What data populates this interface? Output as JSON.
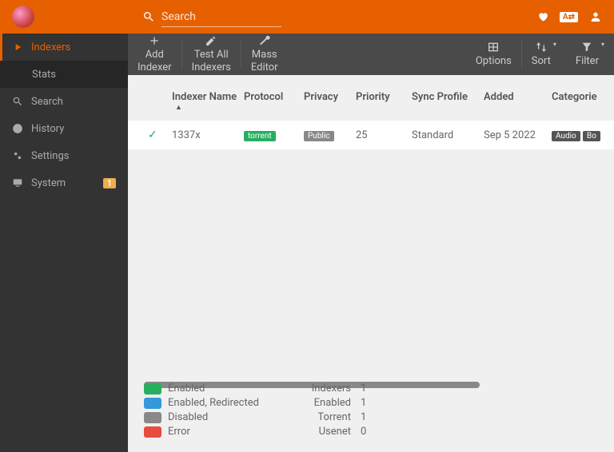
{
  "header": {
    "search_placeholder": "Search",
    "lang": "A⇄"
  },
  "nav": {
    "indexers": "Indexers",
    "stats": "Stats",
    "search": "Search",
    "history": "History",
    "settings": "Settings",
    "system": "System",
    "system_badge": "1"
  },
  "toolbar": {
    "add": "Add\nIndexer",
    "test": "Test All\nIndexers",
    "mass": "Mass\nEditor",
    "options": "Options",
    "sort": "Sort",
    "filter": "Filter"
  },
  "columns": {
    "name": "Indexer Name",
    "protocol": "Protocol",
    "privacy": "Privacy",
    "priority": "Priority",
    "sync": "Sync Profile",
    "added": "Added",
    "categories": "Categorie"
  },
  "rows": [
    {
      "name": "1337x",
      "protocol": "torrent",
      "privacy": "Public",
      "priority": "25",
      "sync": "Standard",
      "added": "Sep 5 2022",
      "cat1": "Audio",
      "cat2": "Bo"
    }
  ],
  "legend": {
    "enabled": "Enabled",
    "redirected": "Enabled, Redirected",
    "disabled": "Disabled",
    "error": "Error"
  },
  "stats": {
    "indexers_l": "Indexers",
    "indexers_v": "1",
    "enabled_l": "Enabled",
    "enabled_v": "1",
    "torrent_l": "Torrent",
    "torrent_v": "1",
    "usenet_l": "Usenet",
    "usenet_v": "0"
  }
}
